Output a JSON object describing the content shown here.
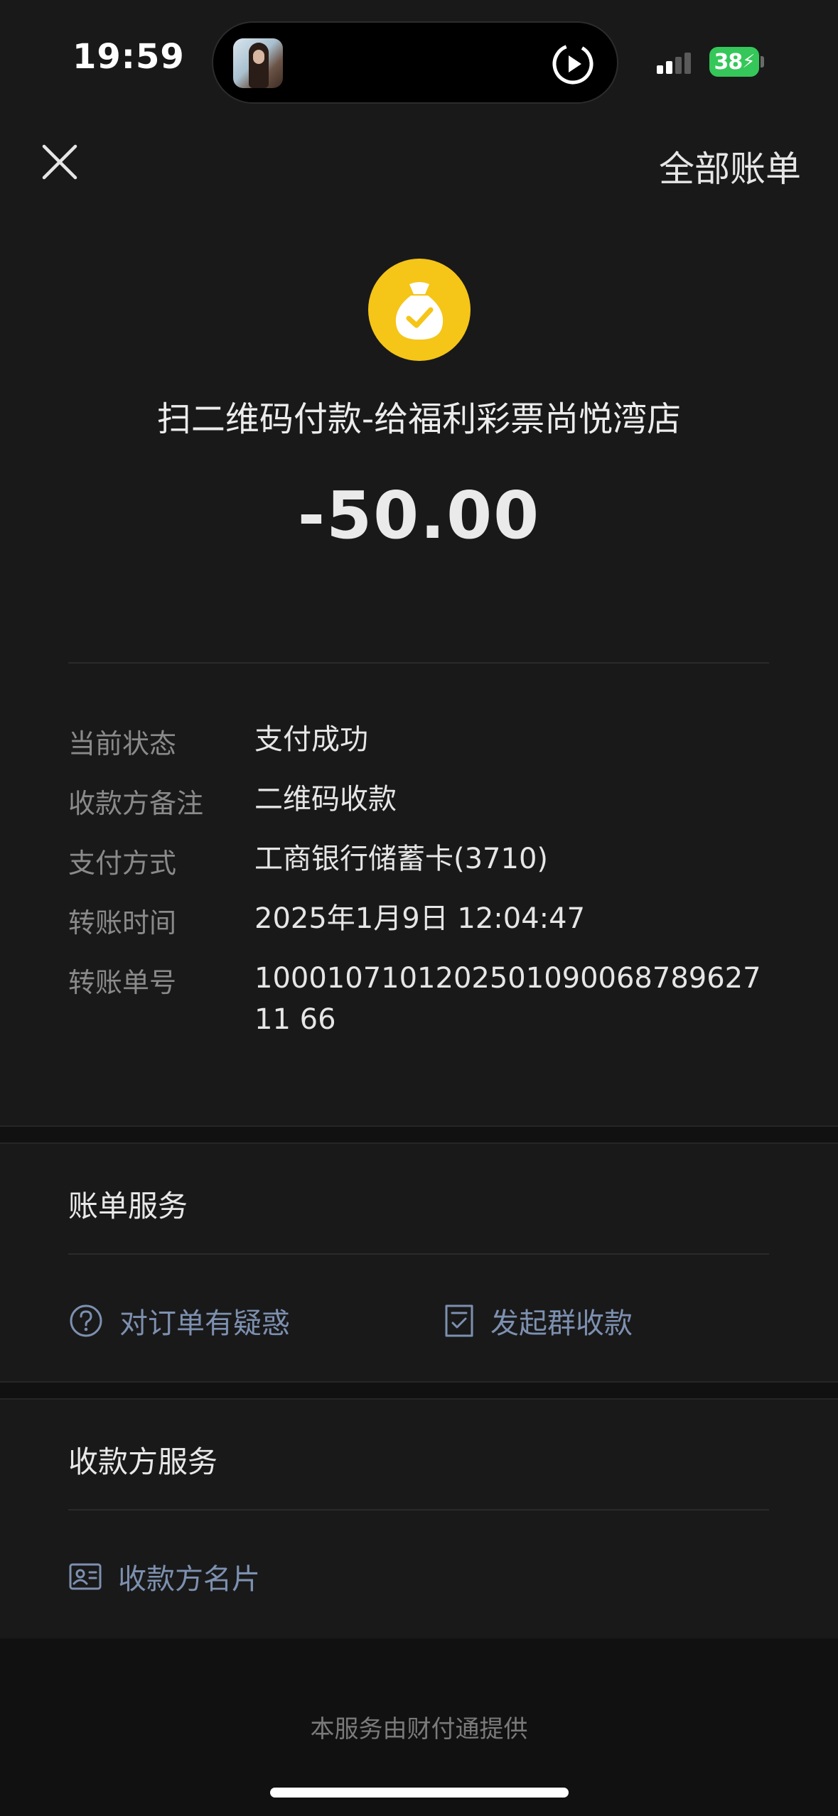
{
  "status_bar": {
    "time": "19:59",
    "battery": "38"
  },
  "nav": {
    "close_icon": "close-icon",
    "all_bills": "全部账单"
  },
  "header": {
    "icon": "money-bag-check-icon",
    "icon_color": "#f5c518",
    "merchant": "扫二维码付款-给福利彩票尚悦湾店",
    "amount": "-50.00"
  },
  "details": [
    {
      "label": "当前状态",
      "value": "支付成功"
    },
    {
      "label": "收款方备注",
      "value": "二维码收款"
    },
    {
      "label": "支付方式",
      "value": "工商银行储蓄卡(3710)"
    },
    {
      "label": "转账时间",
      "value": "2025年1月9日 12:04:47"
    },
    {
      "label": "转账单号",
      "value": "100010710120250109006878962711 66"
    }
  ],
  "bill_service": {
    "title": "账单服务",
    "question_link": "对订单有疑惑",
    "group_collect_link": "发起群收款"
  },
  "payee_service": {
    "title": "收款方服务",
    "payee_card_link": "收款方名片"
  },
  "footer": {
    "provider": "本服务由财付通提供"
  },
  "colors": {
    "background": "#191919",
    "link": "#7d90b0",
    "battery": "#35c759"
  }
}
